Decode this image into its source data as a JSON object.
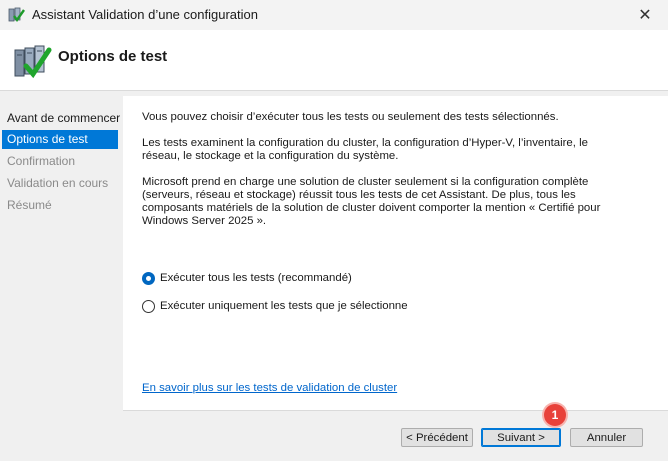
{
  "window": {
    "title": "Assistant Validation d’une configuration",
    "close_glyph": "✕",
    "title_icon": "cluster-validation-icon"
  },
  "header": {
    "title": "Options de test",
    "icon": "server-checkmark-icon"
  },
  "sidebar": {
    "items": [
      {
        "label": "Avant de commencer",
        "state": "normal"
      },
      {
        "label": "Options de test",
        "state": "active"
      },
      {
        "label": "Confirmation",
        "state": "disabled"
      },
      {
        "label": "Validation en cours",
        "state": "disabled"
      },
      {
        "label": "Résumé",
        "state": "disabled"
      }
    ]
  },
  "content": {
    "paragraphs": [
      "Vous pouvez choisir d’exécuter tous les tests ou seulement des tests sélectionnés.",
      "Les tests examinent la configuration du cluster, la configuration d’Hyper-V, l’inventaire, le réseau, le stockage et la configuration du système.",
      "Microsoft prend en charge une solution de cluster seulement si la configuration complète (serveurs, réseau et stockage) réussit tous les tests de cet Assistant. De plus, tous les composants matériels de la solution de cluster doivent comporter la mention « Certifié pour Windows Server 2025 »."
    ],
    "options": [
      {
        "label": "Exécuter tous les tests (recommandé)",
        "checked": true
      },
      {
        "label": "Exécuter uniquement les tests que je sélectionne",
        "checked": false
      }
    ],
    "link": "En savoir plus sur les tests de validation de cluster"
  },
  "footer": {
    "previous_label": "< Précédent",
    "next_label": "Suivant >",
    "cancel_label": "Annuler"
  },
  "annotation": {
    "badge_number": "1",
    "color": "#e8413a"
  },
  "colors": {
    "accent": "#0078d7",
    "link": "#0066cc"
  }
}
